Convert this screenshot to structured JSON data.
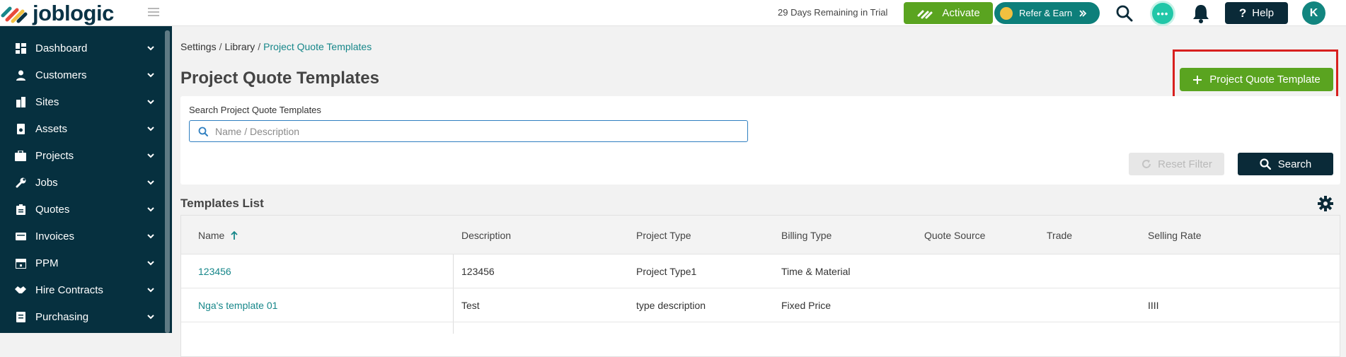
{
  "brand": {
    "name": "joblogic"
  },
  "topbar": {
    "trial_text": "29 Days Remaining in Trial",
    "activate_label": "Activate",
    "refer_label": "Refer & Earn",
    "chat_dots": "•••",
    "help_label": "Help",
    "avatar_initial": "K"
  },
  "sidebar": {
    "items": [
      {
        "label": "Dashboard",
        "icon": "dashboard-icon"
      },
      {
        "label": "Customers",
        "icon": "person-icon"
      },
      {
        "label": "Sites",
        "icon": "building-icon"
      },
      {
        "label": "Assets",
        "icon": "asset-icon"
      },
      {
        "label": "Projects",
        "icon": "projects-icon"
      },
      {
        "label": "Jobs",
        "icon": "wrench-icon"
      },
      {
        "label": "Quotes",
        "icon": "clipboard-icon"
      },
      {
        "label": "Invoices",
        "icon": "invoice-icon"
      },
      {
        "label": "PPM",
        "icon": "calendar-icon"
      },
      {
        "label": "Hire Contracts",
        "icon": "handshake-icon"
      },
      {
        "label": "Purchasing",
        "icon": "purchasing-icon"
      }
    ]
  },
  "breadcrumb": {
    "settings": "Settings",
    "library": "Library",
    "current": "Project Quote Templates",
    "sep": "/"
  },
  "page": {
    "title": "Project Quote Templates",
    "add_button_label": "Project Quote Template"
  },
  "search": {
    "label": "Search Project Quote Templates",
    "placeholder": "Name / Description",
    "value": "",
    "reset_label": "Reset Filter",
    "search_label": "Search"
  },
  "templates": {
    "title": "Templates List",
    "columns": [
      "Name",
      "Description",
      "Project Type",
      "Billing Type",
      "Quote Source",
      "Trade",
      "Selling Rate"
    ],
    "rows": [
      [
        "123456",
        "123456",
        "Project Type1",
        "Time & Material",
        "",
        "",
        ""
      ],
      [
        "Nga's template 01",
        "Test",
        "type description",
        "Fixed Price",
        "",
        "",
        "IIII"
      ]
    ]
  },
  "colors": {
    "sidebar_bg": "#06303f",
    "accent_green": "#5aa420",
    "teal": "#17878a",
    "dark_navy": "#0a2a38",
    "highlight_red": "#d8201f"
  }
}
